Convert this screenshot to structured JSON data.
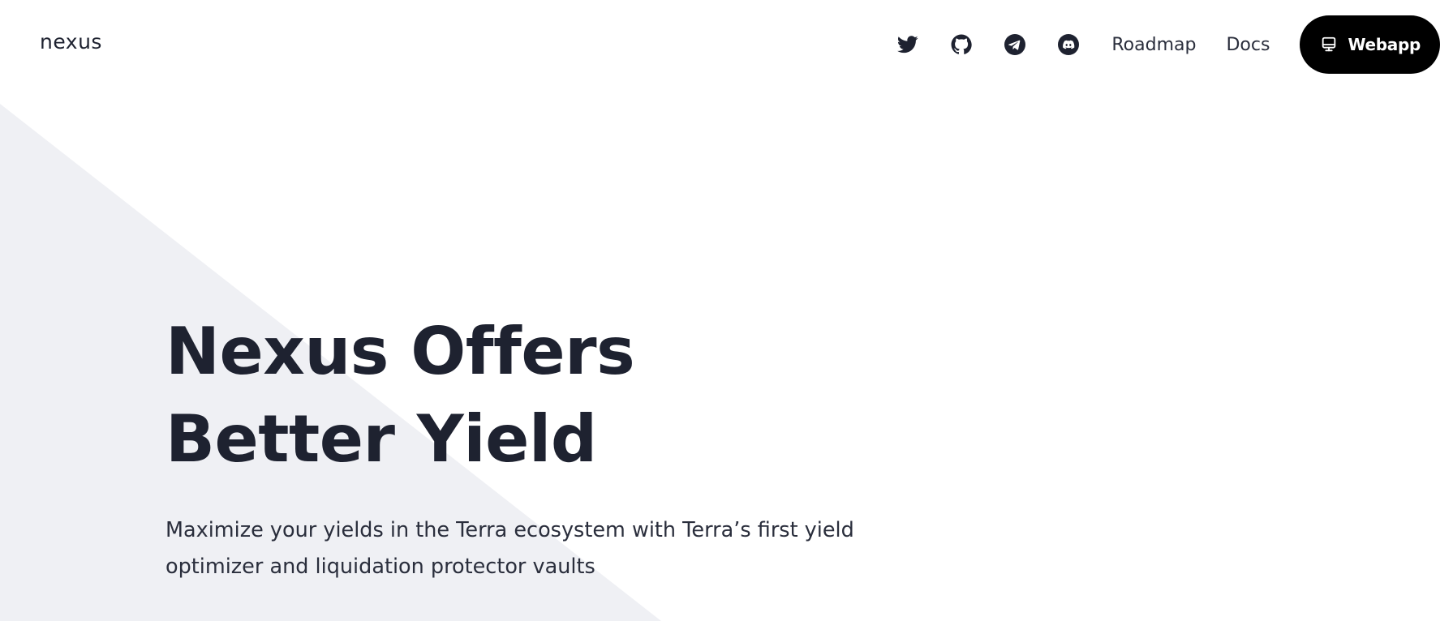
{
  "brand": {
    "logo_text": "nexus"
  },
  "nav": {
    "social": [
      {
        "name": "twitter-icon"
      },
      {
        "name": "github-icon"
      },
      {
        "name": "telegram-icon"
      },
      {
        "name": "discord-icon"
      }
    ],
    "links": [
      {
        "label": "Roadmap"
      },
      {
        "label": "Docs"
      }
    ],
    "cta": {
      "label": "Webapp",
      "icon": "monitor-icon"
    }
  },
  "hero": {
    "title_line_1": "Nexus Offers",
    "title_line_2": "Better Yield",
    "subtitle": "Maximize your yields in the Terra ecosystem with Terra’s first yield optimizer and liquidation protector vaults"
  },
  "colors": {
    "text_primary": "#1e2230",
    "background": "#ffffff",
    "background_shape": "#eff0f4",
    "button_bg": "#000000",
    "button_text": "#ffffff"
  }
}
